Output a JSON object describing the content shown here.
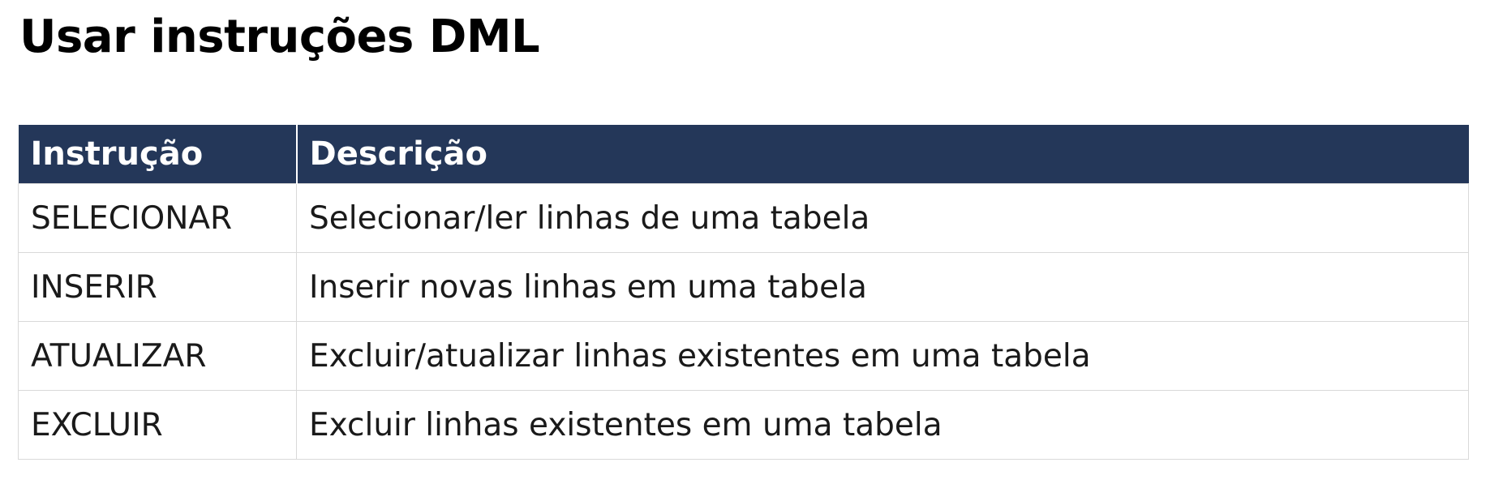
{
  "title": "Usar instruções DML",
  "table": {
    "headers": [
      "Instrução",
      "Descrição"
    ],
    "rows": [
      {
        "instruction": "SELECIONAR",
        "description": "Selecionar/ler linhas de uma tabela"
      },
      {
        "instruction": "INSERIR",
        "description": "Inserir novas linhas em uma tabela"
      },
      {
        "instruction": "ATUALIZAR",
        "description": "Excluir/atualizar linhas existentes em uma tabela"
      },
      {
        "instruction": "EXCLUIR",
        "description": "Excluir linhas existentes em uma tabela"
      }
    ]
  },
  "colors": {
    "header_background": "#243759",
    "header_text": "#ffffff",
    "border": "#d9d9d9"
  }
}
